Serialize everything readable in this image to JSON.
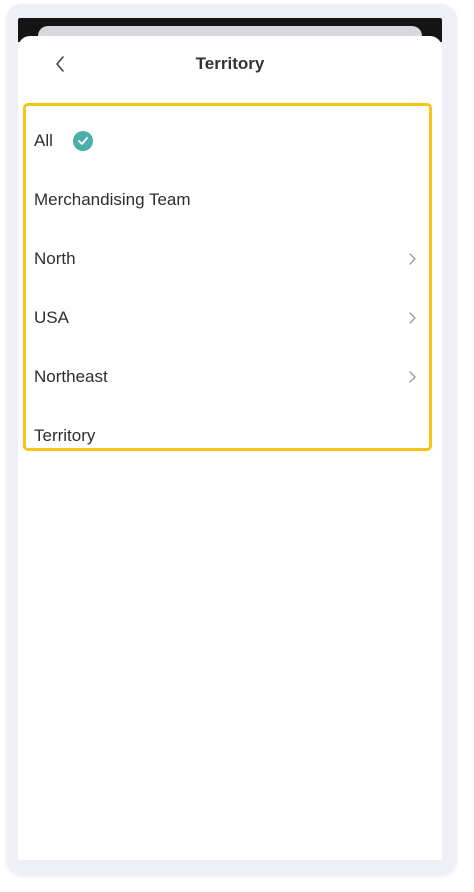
{
  "header": {
    "title": "Territory"
  },
  "list": {
    "items": [
      {
        "label": "All",
        "selected": true,
        "has_children": false
      },
      {
        "label": "Merchandising Team",
        "selected": false,
        "has_children": false
      },
      {
        "label": "North",
        "selected": false,
        "has_children": true
      },
      {
        "label": "USA",
        "selected": false,
        "has_children": true
      },
      {
        "label": "Northeast",
        "selected": false,
        "has_children": true
      },
      {
        "label": "Territory",
        "selected": false,
        "has_children": false
      }
    ]
  },
  "colors": {
    "highlight_border": "#f5c518",
    "check_accent": "#4aaeaa",
    "frame_background": "#eff0f6"
  }
}
